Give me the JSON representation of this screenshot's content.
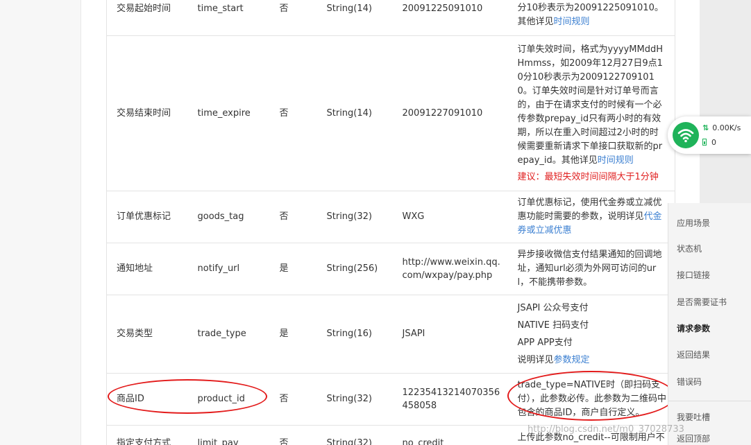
{
  "table": {
    "rows": [
      {
        "name": "交易起始时间",
        "param": "time_start",
        "required": "否",
        "type": "String(14)",
        "example": "20091225091010",
        "desc": [
          "分10秒表示为20091225091010。其他详见"
        ],
        "desc_link": "时间规则"
      },
      {
        "name": "交易结束时间",
        "param": "time_expire",
        "required": "否",
        "type": "String(14)",
        "example": "20091227091010",
        "desc": [
          "订单失效时间，格式为yyyyMMddHHmmss，如2009年12月27日9点10分10秒表示为20091227091010。订单失效时间是针对订单号而言的，由于在请求支付的时候有一个必传参数prepay_id只有两小时的有效期，所以在重入时间超过2小时的时候需要重新请求下单接口获取新的prepay_id。其他详见"
        ],
        "desc_link": "时间规则",
        "warning": "建议：最短失效时间间隔大于1分钟"
      },
      {
        "name": "订单优惠标记",
        "param": "goods_tag",
        "required": "否",
        "type": "String(32)",
        "example": "WXG",
        "desc": [
          "订单优惠标记，使用代金券或立减优惠功能时需要的参数，说明详见"
        ],
        "desc_link": "代金券或立减优惠"
      },
      {
        "name": "通知地址",
        "param": "notify_url",
        "required": "是",
        "type": "String(256)",
        "example": "http://www.weixin.qq.com/wxpay/pay.php",
        "desc": [
          "异步接收微信支付结果通知的回调地址，通知url必须为外网可访问的url，不能携带参数。"
        ]
      },
      {
        "name": "交易类型",
        "param": "trade_type",
        "required": "是",
        "type": "String(16)",
        "example": "JSAPI",
        "desc_lines": [
          "JSAPI 公众号支付",
          "NATIVE 扫码支付",
          "APP APP支付"
        ],
        "desc_tail": "说明详见",
        "desc_link": "参数规定"
      },
      {
        "name": "商品ID",
        "param": "product_id",
        "required": "否",
        "type": "String(32)",
        "example": "12235413214070356458058",
        "desc": [
          "trade_type=NATIVE时（即扫码支付），此参数必传。此参数为二维码中包含的商品ID，商户自行定义。"
        ]
      },
      {
        "name": "指定支付方式",
        "param": "limit_pay",
        "required": "否",
        "type": "String(32)",
        "example": "no_credit",
        "desc": [
          "上传此参数no_credit--可限制用户不"
        ]
      }
    ]
  },
  "network_widget": {
    "speed": "0.00K/s",
    "count": "0"
  },
  "side_nav": {
    "items": [
      "应用场景",
      "状态机",
      "接口链接",
      "是否需要证书",
      "请求参数",
      "返回结果",
      "错误码"
    ],
    "bottom_items": [
      "我要吐槽",
      "返回顶部"
    ]
  },
  "watermark": "http://blog.csdn.net/m0_37028733",
  "colors": {
    "annotation": "#e31b1b",
    "link": "#3b7fd1",
    "warning": "#e02020",
    "wifi": "#1fb35a"
  }
}
